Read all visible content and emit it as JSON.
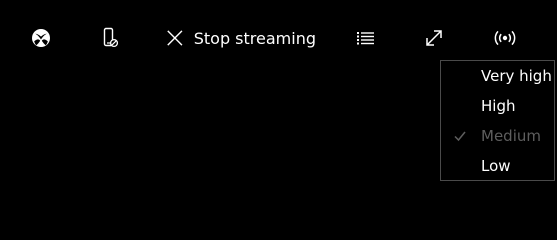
{
  "toolbar": {
    "xbox_button_icon": "xbox-logo-icon",
    "phone_button_icon": "phone-remote-icon",
    "stop_button_icon": "close-icon",
    "stop_label": "Stop streaming",
    "list_button_icon": "list-icon",
    "fullscreen_button_icon": "expand-icon",
    "quality_button_icon": "broadcast-icon"
  },
  "quality_menu": {
    "items": [
      {
        "label": "Very high",
        "enabled": true,
        "checked": false
      },
      {
        "label": "High",
        "enabled": true,
        "checked": false
      },
      {
        "label": "Medium",
        "enabled": false,
        "checked": true
      },
      {
        "label": "Low",
        "enabled": true,
        "checked": false
      }
    ]
  },
  "colors": {
    "background": "#000000",
    "text": "#ffffff",
    "disabled_text": "#5e5e5e",
    "menu_border": "#4a4a4a"
  }
}
